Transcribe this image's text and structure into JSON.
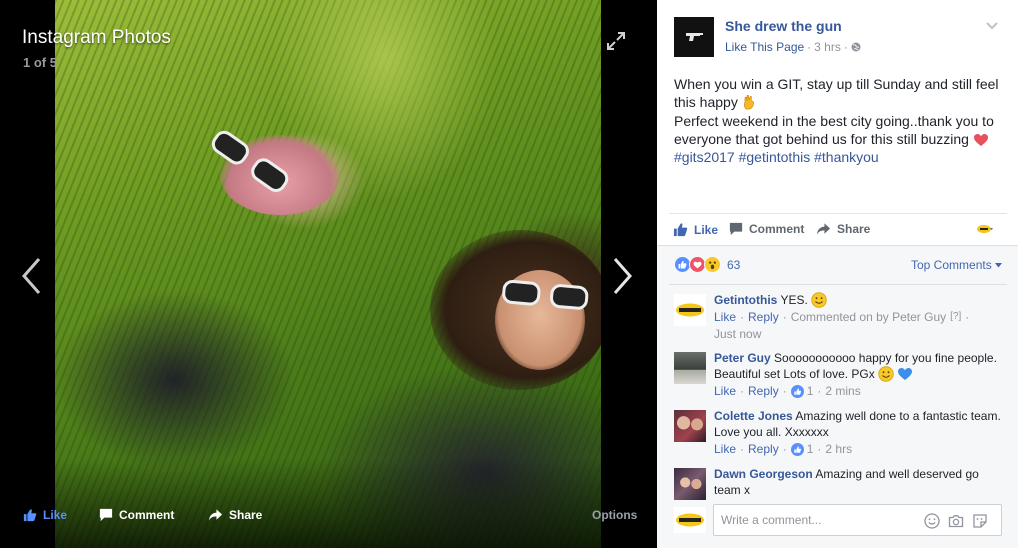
{
  "viewer": {
    "title": "Instagram Photos",
    "counter": "1 of 5",
    "actions": {
      "like": "Like",
      "comment": "Comment",
      "share": "Share",
      "options": "Options"
    },
    "icons": [
      "expand-icon",
      "chevron-left-icon",
      "chevron-right-icon",
      "thumbs-up-icon",
      "comment-icon",
      "share-arrow-icon"
    ]
  },
  "post": {
    "page_name": "She drew the gun",
    "like_page": "Like This Page",
    "separator": "·",
    "time": "3 hrs",
    "line1": "When you win a GIT, stay up till Sunday and still feel this happy",
    "line2": "Perfect weekend in the best city going..thank you to everyone that got behind us for this still buzzing",
    "hashtags": [
      "#gits2017",
      "#getintothis",
      "#thankyou"
    ],
    "actions": {
      "like": "Like",
      "comment": "Comment",
      "share": "Share"
    }
  },
  "reactions": {
    "count": "63",
    "sort_label": "Top Comments",
    "types": [
      "like",
      "love",
      "wow"
    ]
  },
  "comments": [
    {
      "author": "Getintothis",
      "text": "YES.",
      "like": "Like",
      "reply": "Reply",
      "note": "Commented on by Peter Guy",
      "note_badge": "[?]",
      "time": "Just now"
    },
    {
      "author": "Peter Guy",
      "text": "Sooooooooooo happy for you fine people. Beautiful set Lots of love. PGx",
      "like": "Like",
      "reply": "Reply",
      "likes": "1",
      "time": "2 mins"
    },
    {
      "author": "Colette Jones",
      "text": "Amazing well done to a fantastic team. Love you all. Xxxxxxx",
      "like": "Like",
      "reply": "Reply",
      "likes": "1",
      "time": "2 hrs"
    },
    {
      "author": "Dawn Georgeson",
      "text": "Amazing and well deserved go team x"
    }
  ],
  "composer": {
    "placeholder": "Write a comment..."
  },
  "colors": {
    "link": "#365899",
    "accent": "#4267b2",
    "viewer_bg": "#000000",
    "comments_bg": "#f6f7f9",
    "meta_gray": "#90949c"
  }
}
